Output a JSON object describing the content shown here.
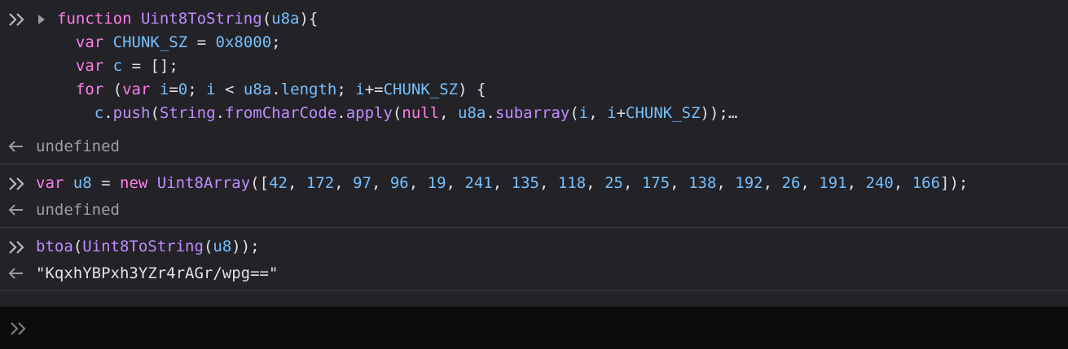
{
  "entries": [
    {
      "input": [
        [
          [
            "kw",
            "function"
          ],
          [
            "plain",
            " "
          ],
          [
            "fn",
            "Uint8ToString"
          ],
          [
            "plain",
            "("
          ],
          [
            "id",
            "u8a"
          ],
          [
            "plain",
            "){"
          ]
        ],
        [
          [
            "plain",
            "  "
          ],
          [
            "kw",
            "var"
          ],
          [
            "plain",
            " "
          ],
          [
            "id",
            "CHUNK_SZ"
          ],
          [
            "plain",
            " = "
          ],
          [
            "numb",
            "0x8000"
          ],
          [
            "plain",
            ";"
          ]
        ],
        [
          [
            "plain",
            "  "
          ],
          [
            "kw",
            "var"
          ],
          [
            "plain",
            " "
          ],
          [
            "id",
            "c"
          ],
          [
            "plain",
            " = [];"
          ]
        ],
        [
          [
            "plain",
            "  "
          ],
          [
            "kw",
            "for"
          ],
          [
            "plain",
            " ("
          ],
          [
            "kw",
            "var"
          ],
          [
            "plain",
            " "
          ],
          [
            "id",
            "i"
          ],
          [
            "plain",
            "="
          ],
          [
            "numb",
            "0"
          ],
          [
            "plain",
            "; "
          ],
          [
            "id",
            "i"
          ],
          [
            "plain",
            " < "
          ],
          [
            "id",
            "u8a"
          ],
          [
            "plain",
            "."
          ],
          [
            "id",
            "length"
          ],
          [
            "plain",
            "; "
          ],
          [
            "id",
            "i"
          ],
          [
            "plain",
            "+="
          ],
          [
            "id",
            "CHUNK_SZ"
          ],
          [
            "plain",
            ") {"
          ]
        ],
        [
          [
            "plain",
            "    "
          ],
          [
            "id",
            "c"
          ],
          [
            "plain",
            "."
          ],
          [
            "fn",
            "push"
          ],
          [
            "plain",
            "("
          ],
          [
            "fn",
            "String"
          ],
          [
            "plain",
            "."
          ],
          [
            "fn",
            "fromCharCode"
          ],
          [
            "plain",
            "."
          ],
          [
            "fn",
            "apply"
          ],
          [
            "plain",
            "("
          ],
          [
            "kw",
            "null"
          ],
          [
            "plain",
            ", "
          ],
          [
            "id",
            "u8a"
          ],
          [
            "plain",
            "."
          ],
          [
            "fn",
            "subarray"
          ],
          [
            "plain",
            "("
          ],
          [
            "id",
            "i"
          ],
          [
            "plain",
            ", "
          ],
          [
            "id",
            "i"
          ],
          [
            "plain",
            "+"
          ],
          [
            "id",
            "CHUNK_SZ"
          ],
          [
            "plain",
            "));"
          ],
          [
            "plain",
            "…"
          ]
        ]
      ],
      "collapsed": true,
      "result": "undefined"
    },
    {
      "input": [
        [
          [
            "kw",
            "var"
          ],
          [
            "plain",
            " "
          ],
          [
            "id",
            "u8"
          ],
          [
            "plain",
            " = "
          ],
          [
            "kw",
            "new"
          ],
          [
            "plain",
            " "
          ],
          [
            "fn",
            "Uint8Array"
          ],
          [
            "plain",
            "(["
          ],
          [
            "numb",
            "42"
          ],
          [
            "plain",
            ", "
          ],
          [
            "numb",
            "172"
          ],
          [
            "plain",
            ", "
          ],
          [
            "numb",
            "97"
          ],
          [
            "plain",
            ", "
          ],
          [
            "numb",
            "96"
          ],
          [
            "plain",
            ", "
          ],
          [
            "numb",
            "19"
          ],
          [
            "plain",
            ", "
          ],
          [
            "numb",
            "241"
          ],
          [
            "plain",
            ", "
          ],
          [
            "numb",
            "135"
          ],
          [
            "plain",
            ", "
          ],
          [
            "numb",
            "118"
          ],
          [
            "plain",
            ", "
          ],
          [
            "numb",
            "25"
          ],
          [
            "plain",
            ", "
          ],
          [
            "numb",
            "175"
          ],
          [
            "plain",
            ", "
          ],
          [
            "numb",
            "138"
          ],
          [
            "plain",
            ", "
          ],
          [
            "numb",
            "192"
          ],
          [
            "plain",
            ", "
          ],
          [
            "numb",
            "26"
          ],
          [
            "plain",
            ", "
          ],
          [
            "numb",
            "191"
          ],
          [
            "plain",
            ", "
          ],
          [
            "numb",
            "240"
          ],
          [
            "plain",
            ", "
          ],
          [
            "numb",
            "166"
          ],
          [
            "plain",
            "]);"
          ]
        ]
      ],
      "collapsed": false,
      "result": "undefined"
    },
    {
      "input": [
        [
          [
            "fn",
            "btoa"
          ],
          [
            "plain",
            "("
          ],
          [
            "fn",
            "Uint8ToString"
          ],
          [
            "plain",
            "("
          ],
          [
            "id",
            "u8"
          ],
          [
            "plain",
            "));"
          ]
        ]
      ],
      "collapsed": false,
      "result": "\"KqxhYBPxh3YZr4rAGr/wpg==\""
    }
  ],
  "icons": {
    "prompt": "double-chevron-right-icon",
    "result": "arrow-left-icon",
    "toggle": "triangle-right-icon"
  },
  "colors": {
    "keyword": "#ff7de9",
    "function": "#bf8cff",
    "identifier": "#75bfff",
    "number": "#75bfff",
    "background": "#232327",
    "input_background": "#0c0c0d"
  }
}
